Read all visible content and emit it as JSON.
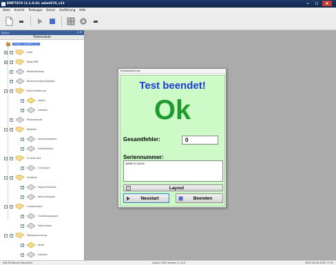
{
  "window": {
    "title": "EMFTS70 (2.1.6.0): admt670_v21"
  },
  "menu": [
    "Datei",
    "Ansicht",
    "Testsuppe",
    "Extras",
    "Ausführung",
    "Hilfe"
  ],
  "panel": {
    "header": "Ablauf",
    "column": "Testmodule",
    "project": "Projekt: admt670_v21",
    "items": [
      "Suite",
      "Bilder/PDF",
      "Netzanbindung",
      "Bezeichnungen/Adaption",
      "Dokumentierung",
      "Vorteil",
      "Initialien",
      "Personenliste",
      "Netztest",
      "Verbindungstest",
      "Isolationstest",
      "E-Gerät Test",
      "E-Gruppe1",
      "Sichttest",
      "Passive Bauteile",
      "Aktive Bauteile",
      "Funktionstest",
      "Funktionsgruppe1",
      "Motortreiber",
      "Testabschlussung",
      "Reset",
      "Initialien"
    ]
  },
  "dialog": {
    "title": "Endauswertung",
    "headline": "Test beendet!",
    "result": "Ok",
    "error_label": "Gesamtfehler:",
    "error_value": "0",
    "serial_label": "Seriennummer:",
    "serial_value": "ADM670_00016",
    "layout_button": "Layout",
    "start_button": "Neustart",
    "end_button": "Beenden"
  },
  "status": {
    "left": "DIN-EN Bereit (Neustart)",
    "center": "Lizenz: MSE Version 2.1.6.0",
    "right": "NUM  16.08.2016  17:55"
  }
}
